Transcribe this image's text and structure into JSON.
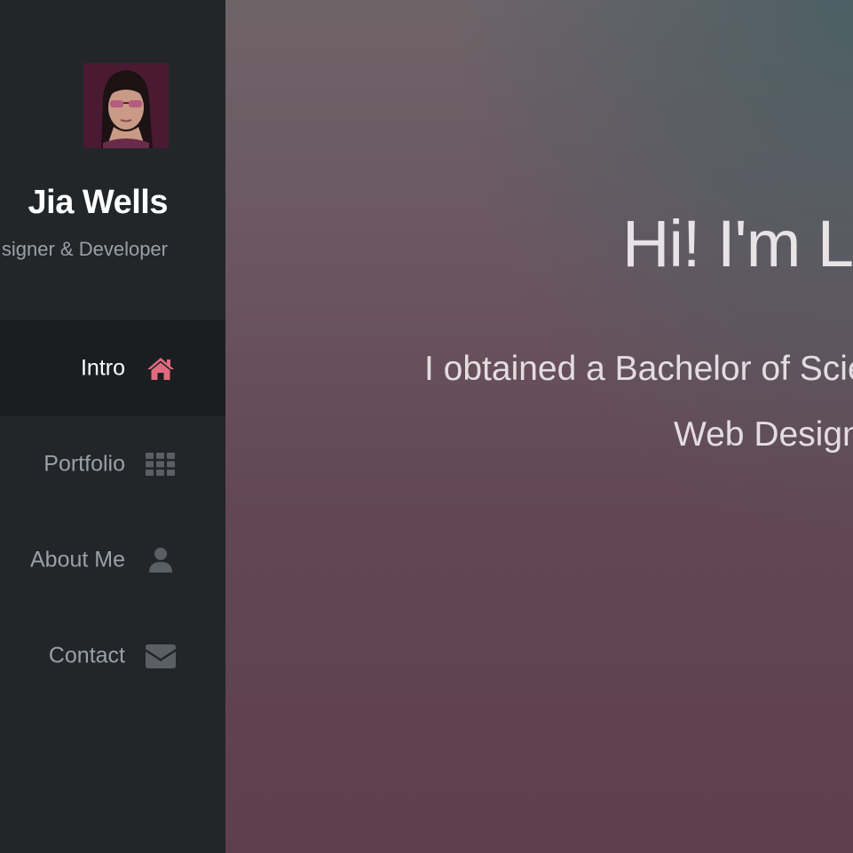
{
  "profile": {
    "name": "Jia Wells",
    "role": "signer & Developer"
  },
  "nav": {
    "items": [
      {
        "label": "Intro",
        "icon": "home-icon",
        "active": true
      },
      {
        "label": "Portfolio",
        "icon": "grid-icon",
        "active": false
      },
      {
        "label": "About Me",
        "icon": "user-icon",
        "active": false
      },
      {
        "label": "Contact",
        "icon": "envelope-icon",
        "active": false
      }
    ]
  },
  "hero": {
    "title": "Hi! I'm L",
    "line1": "I obtained a Bachelor of Scie",
    "line2": "Web Design"
  },
  "colors": {
    "sidebar_bg": "#222629",
    "active_item_bg": "#1b1e21",
    "accent": "#e06a80",
    "muted_text": "#9aa0a5",
    "muted_icon": "#5a5f64"
  }
}
